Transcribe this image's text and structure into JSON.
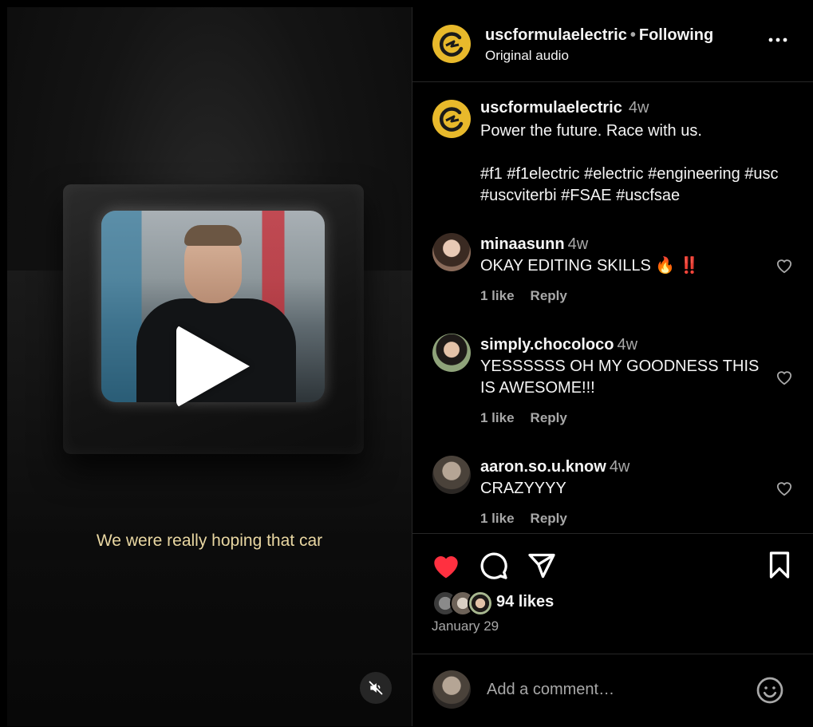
{
  "video": {
    "subtitle": "We were really hoping that car"
  },
  "header": {
    "username": "uscformulaelectric",
    "separator": "•",
    "follow_status": "Following",
    "audio": "Original audio",
    "more_icon": "more-horizontal-icon"
  },
  "caption": {
    "username": "uscformulaelectric",
    "time": "4w",
    "text": "Power the future. Race with us.",
    "hashtags_line1": "#f1 #f1electric #electric #engineering #usc",
    "hashtags_line2": "#uscviterbi #FSAE #uscfsae"
  },
  "comments": [
    {
      "username": "minaasunn",
      "time": "4w",
      "text": "OKAY EDITING SKILLS 🔥 ‼️",
      "likes": "1 like",
      "reply": "Reply"
    },
    {
      "username": "simply.chocoloco",
      "time": "4w",
      "text": "YESSSSSS OH MY GOODNESS THIS IS AWESOME!!!",
      "likes": "1 like",
      "reply": "Reply"
    },
    {
      "username": "aaron.so.u.know",
      "time": "4w",
      "text": "CRAZYYYY",
      "likes": "1 like",
      "reply": "Reply"
    }
  ],
  "actions": {
    "like_icon": "heart-filled-icon",
    "comment_icon": "comment-icon",
    "share_icon": "send-icon",
    "save_icon": "bookmark-icon",
    "like_color": "#ff3040"
  },
  "likes_text": "94 likes",
  "date": "January 29",
  "add_comment": {
    "placeholder": "Add a comment…",
    "emoji_icon": "emoji-icon"
  },
  "colors": {
    "background": "#000000",
    "text": "#f5f5f5",
    "secondary": "#a8a8a8",
    "brand_yellow": "#e8b92b",
    "subtitle": "#e9d7a2"
  }
}
